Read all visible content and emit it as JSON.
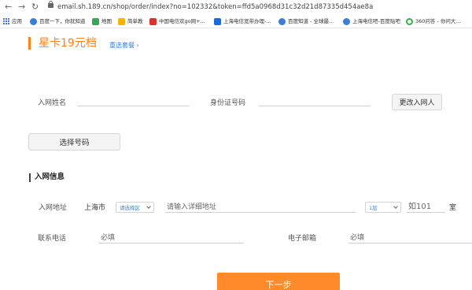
{
  "browser": {
    "url": "email.sh.189.cn/shop/order/index?no=102332&token=ffd5a0968d31c32d21d87335d454ae8a",
    "bookmarks": [
      {
        "label": "应用",
        "color": "#4a72d6"
      },
      {
        "label": "百度一下，你就知道",
        "color": "#3b7fd4"
      },
      {
        "label": "地图",
        "color": "#34a853"
      },
      {
        "label": "简单教",
        "color": "#f4b400"
      },
      {
        "label": "中国电信欢go网+...",
        "color": "#d9342b"
      },
      {
        "label": "上海电信宽带办理-...",
        "color": "#1e6bd6"
      },
      {
        "label": "百度知道 - 全球最...",
        "color": "#3b7fd4"
      },
      {
        "label": "上海电信吧-百度贴吧",
        "color": "#3b7fd4"
      },
      {
        "label": "360问答 - 你问大...",
        "color": "#36b04a"
      }
    ]
  },
  "plan": {
    "title": "星卡19元档",
    "change_link": "重选套餐 ›"
  },
  "personal": {
    "name_label": "入网姓名",
    "name_value": "",
    "id_label": "身份证号码",
    "id_value": "",
    "change_person_button": "更改入网人",
    "select_number_button": "选择号码"
  },
  "network_info": {
    "section_title": "入网信息",
    "address_label": "入网地址",
    "city": "上海市",
    "district_select": "请选择区",
    "address_placeholder": "请输入详细地址",
    "floor_select": "1层",
    "room_placeholder": "如101",
    "room_suffix": "室",
    "phone_label": "联系电话",
    "phone_placeholder": "必填",
    "email_label": "电子邮箱",
    "email_placeholder": "必填"
  },
  "submit_button": "下一步",
  "colors": {
    "accent": "#ff7f1a",
    "link": "#3b7fd4",
    "submit": "#ff8a2a"
  }
}
